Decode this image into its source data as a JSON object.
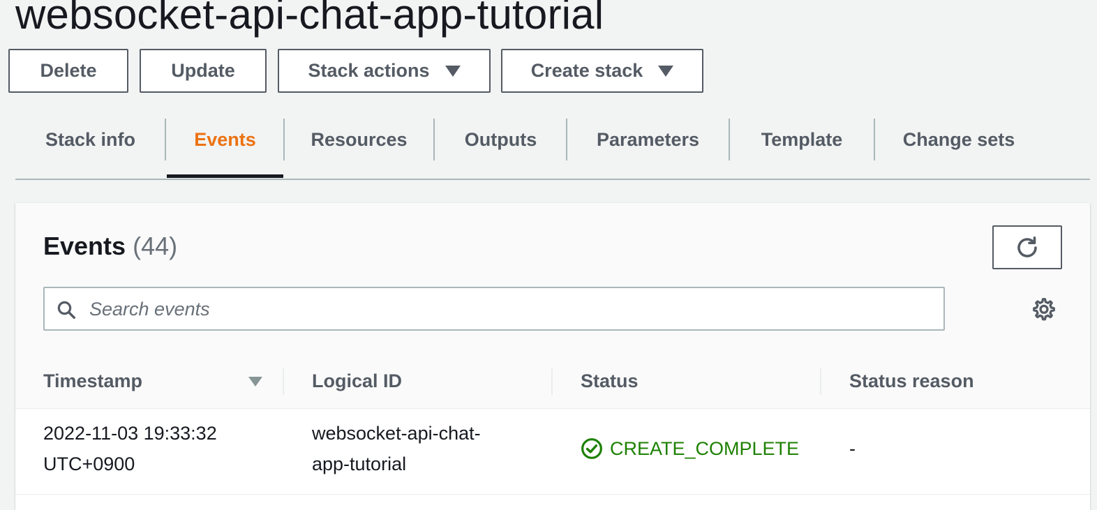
{
  "page": {
    "title": "websocket-api-chat-app-tutorial"
  },
  "toolbar": {
    "delete_label": "Delete",
    "update_label": "Update",
    "stack_actions_label": "Stack actions",
    "create_stack_label": "Create stack"
  },
  "tabs": [
    {
      "label": "Stack info"
    },
    {
      "label": "Events"
    },
    {
      "label": "Resources"
    },
    {
      "label": "Outputs"
    },
    {
      "label": "Parameters"
    },
    {
      "label": "Template"
    },
    {
      "label": "Change sets"
    }
  ],
  "active_tab": "Events",
  "events": {
    "heading": "Events",
    "count": "(44)",
    "search_placeholder": "Search events",
    "columns": [
      "Timestamp",
      "Logical ID",
      "Status",
      "Status reason"
    ],
    "rows": [
      {
        "timestamp_line1": "2022-11-03 19:33:32",
        "timestamp_line2": "UTC+0900",
        "logical_id_line1": "websocket-api-chat-",
        "logical_id_line2": "app-tutorial",
        "status": "CREATE_COMPLETE",
        "status_reason": "-"
      }
    ]
  },
  "colors": {
    "accent": "#ec7211",
    "success": "#1d8102",
    "text": "#16191f",
    "secondary_text": "#545b64",
    "background": "#f2f3f3"
  },
  "icons": {
    "refresh": "refresh-icon",
    "search": "search-icon",
    "settings": "gear-icon",
    "status": "check-circle-icon",
    "dropdown": "caret-down-icon"
  }
}
